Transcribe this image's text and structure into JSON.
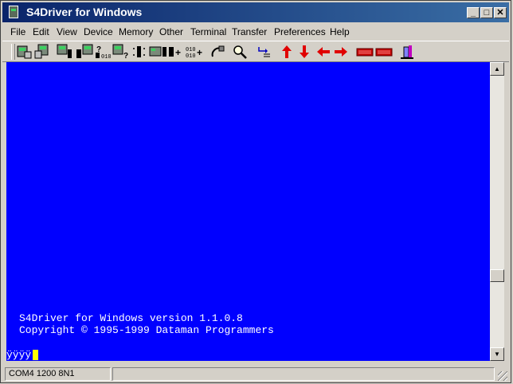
{
  "window": {
    "title": "S4Driver for Windows"
  },
  "title_buttons": {
    "minimize": "_",
    "maximize": "□",
    "close": "✕"
  },
  "menu": [
    "File",
    "Edit",
    "View",
    "Device",
    "Memory",
    "Other",
    "Terminal",
    "Transfer",
    "Preferences",
    "Help"
  ],
  "toolbar_icons": [
    "device-connect-icon",
    "device-transfer-icon",
    "chip-read-icon",
    "chip-write-icon",
    "chip-verify-icon",
    "chip-blank-icon",
    "chip-erase-icon",
    "memory-add-icon",
    "memory-fill-icon",
    "terminal-plug-icon",
    "search-icon",
    "enter-icon",
    "arrow-up-icon",
    "arrow-down-icon",
    "arrow-left-icon",
    "arrow-right-icon",
    "esc-key-icon",
    "ent-key-icon",
    "exit-door-icon"
  ],
  "terminal": {
    "line1": "S4Driver for Windows version 1.1.0.8",
    "line2": "Copyright © 1995-1999 Dataman Programmers",
    "prompt": "ÿÿÿÿ",
    "background": "#0000ff",
    "cursor_color": "#ffff00"
  },
  "scrollbar": {
    "up": "▲",
    "down": "▼"
  },
  "status": {
    "port": "COM4 1200 8N1"
  }
}
